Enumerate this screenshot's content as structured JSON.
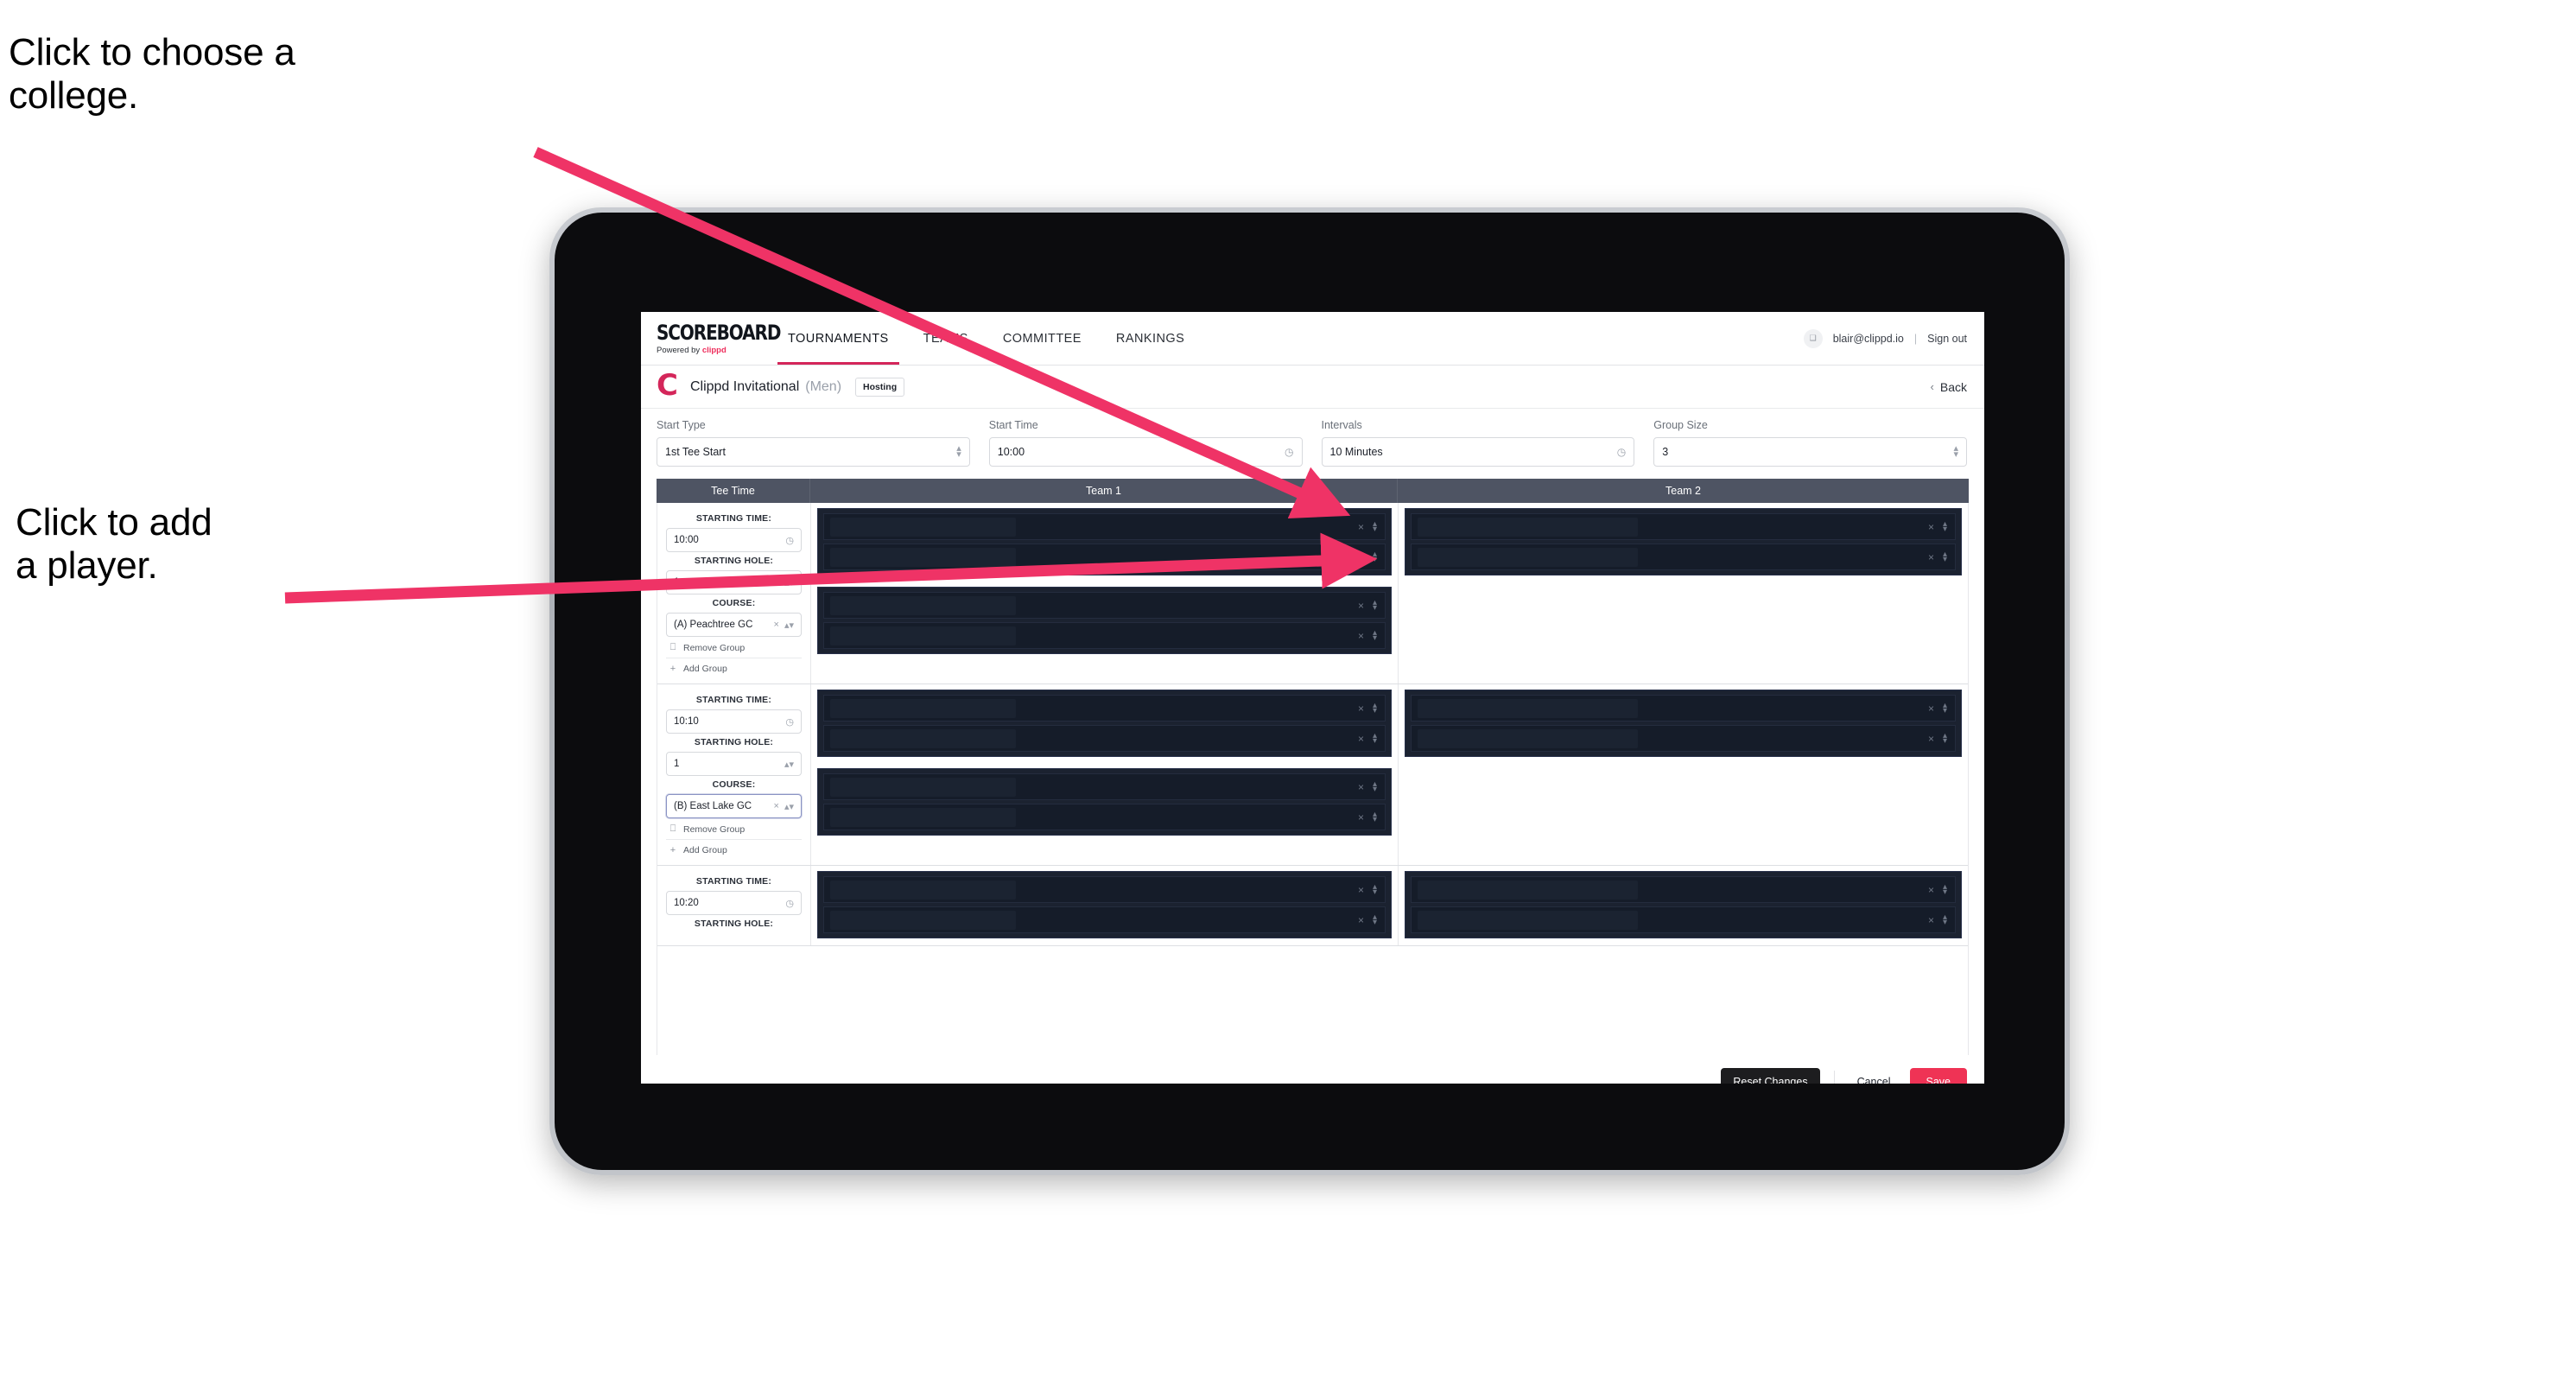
{
  "annotations": {
    "college": "Click to choose a\ncollege.",
    "player": "Click to add\na player."
  },
  "colors": {
    "accent_pink": "#ef3355",
    "annotation_arrow": "#ef3366",
    "table_header": "#4e5463",
    "dark_row": "#151c29",
    "brand_red": "#d4265a"
  },
  "app": {
    "topnav": {
      "logo_word": "SCOREBOARD",
      "logo_sub_prefix": "Powered by ",
      "logo_sub_brand": "clippd",
      "links": [
        {
          "label": "TOURNAMENTS",
          "active": true
        },
        {
          "label": "TEAMS",
          "active": false
        },
        {
          "label": "COMMITTEE",
          "active": false
        },
        {
          "label": "RANKINGS",
          "active": false
        }
      ],
      "avatar_glyph": "❑",
      "email": "blair@clippd.io",
      "separator": "|",
      "sign_out": "Sign out"
    },
    "titlebar": {
      "brand_mark": "C",
      "tournament_name": "Clippd Invitational",
      "gender": "(Men)",
      "badge": "Hosting",
      "back_chevron": "‹",
      "back_label": "Back"
    },
    "controls": [
      {
        "label": "Start Type",
        "value": "1st Tee Start",
        "icon": "stepper"
      },
      {
        "label": "Start Time",
        "value": "10:00",
        "icon": "clock"
      },
      {
        "label": "Intervals",
        "value": "10 Minutes",
        "icon": "clock"
      },
      {
        "label": "Group Size",
        "value": "3",
        "icon": "stepper"
      }
    ],
    "table": {
      "headers": {
        "tee_time": "Tee Time",
        "team1": "Team 1",
        "team2": "Team 2"
      },
      "labels": {
        "starting_time": "STARTING TIME:",
        "starting_hole": "STARTING HOLE:",
        "course": "COURSE:",
        "remove_group": "Remove Group",
        "add_group": "Add Group",
        "remove_icon": "☐",
        "add_icon": "+",
        "clock_icon": "◷",
        "clear_icon": "×"
      },
      "rows": [
        {
          "starting_time": "10:00",
          "starting_hole": "1",
          "course": "(A) Peachtree GC",
          "course_focused": false,
          "team1_groups": [
            {
              "players": [
                {
                  "redacted": true
                },
                {
                  "redacted": true
                }
              ]
            },
            {
              "players": [
                {
                  "redacted": true
                },
                {
                  "redacted": true
                }
              ]
            }
          ],
          "team2_groups": [
            {
              "players": [
                {
                  "redacted": true
                },
                {
                  "redacted": true
                }
              ]
            }
          ]
        },
        {
          "starting_time": "10:10",
          "starting_hole": "1",
          "course": "(B) East Lake GC",
          "course_focused": true,
          "team1_groups": [
            {
              "players": [
                {
                  "redacted": true
                },
                {
                  "redacted": true
                }
              ]
            },
            {
              "players": [
                {
                  "redacted": true
                },
                {
                  "redacted": true
                }
              ]
            }
          ],
          "team2_groups": [
            {
              "players": [
                {
                  "redacted": true
                },
                {
                  "redacted": true
                }
              ]
            }
          ]
        },
        {
          "starting_time": "10:20",
          "starting_hole": "",
          "course": "",
          "partial": true,
          "team1_groups": [
            {
              "players": [
                {
                  "redacted": true
                },
                {
                  "redacted": true
                }
              ]
            }
          ],
          "team2_groups": [
            {
              "players": [
                {
                  "redacted": true
                },
                {
                  "redacted": true
                }
              ]
            }
          ]
        }
      ]
    },
    "footer": {
      "reset": "Reset Changes",
      "cancel": "Cancel",
      "save": "Save"
    }
  }
}
